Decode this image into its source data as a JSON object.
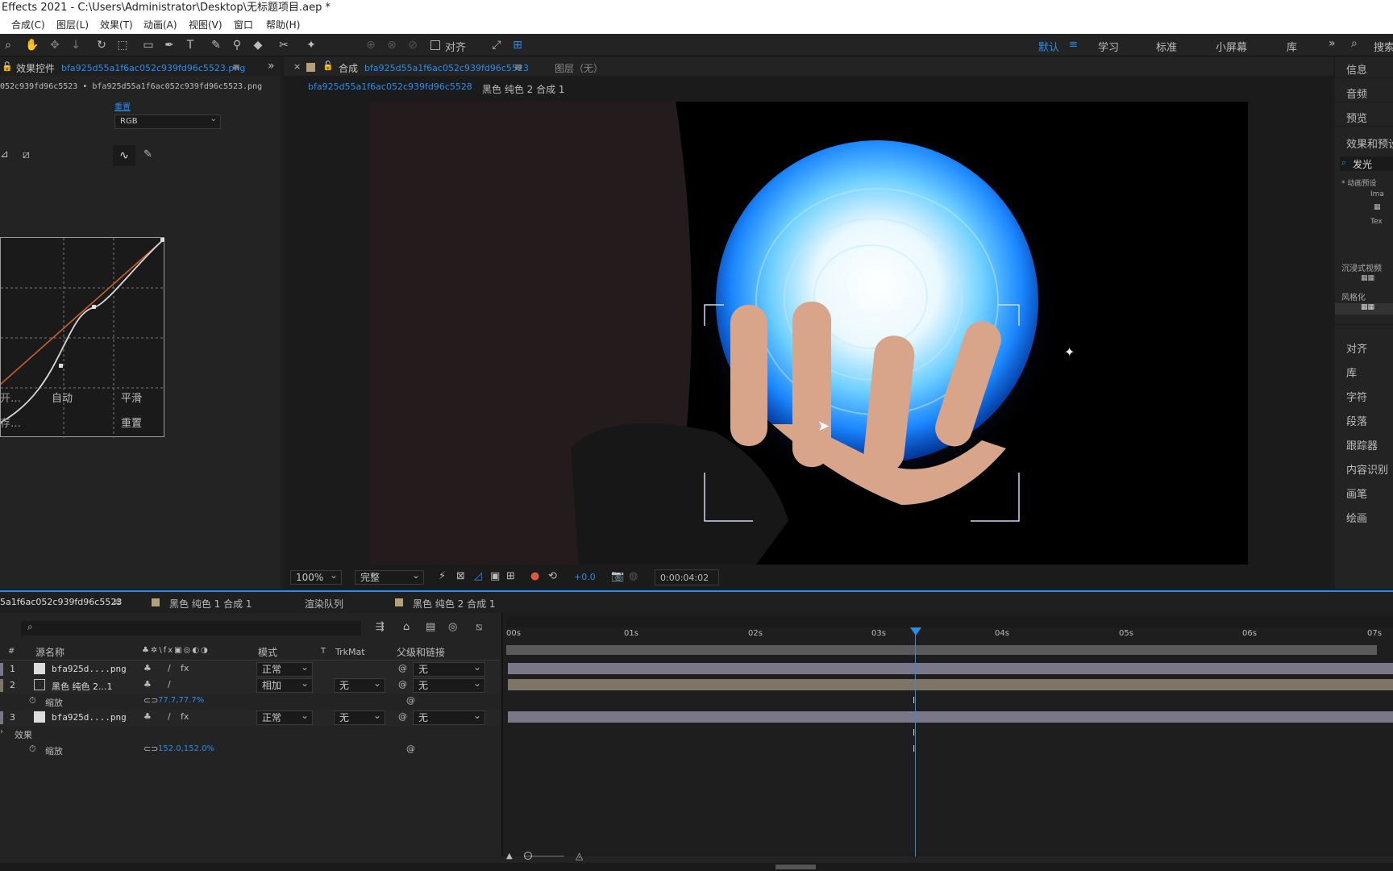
{
  "title": "Effects 2021 - C:\\Users\\Administrator\\Desktop\\无标题项目.aep *",
  "menu": [
    "合成(C)",
    "图层(L)",
    "效果(T)",
    "动画(A)",
    "视图(V)",
    "窗口",
    "帮助(H)"
  ],
  "toolbar": {
    "align_label": "对齐",
    "workspaces": [
      "默认",
      "学习",
      "标准",
      "小屏幕",
      "库"
    ],
    "search_label": "搜索"
  },
  "effects": {
    "tab_label": "效果控件",
    "layer_name": "bfa925d55a1f6ac052c939fd96c5523.png",
    "path": "052c939fd96c5523 • bfa925d55a1f6ac052c939fd96c5523.png",
    "reset_label": "重置",
    "channel": "RGB",
    "buttons": {
      "auto": "自动",
      "smooth": "平滑",
      "reset": "重置",
      "open": "开…",
      "save": "存…"
    }
  },
  "comp": {
    "tab_label": "合成",
    "comp_name": "bfa925d55a1f6ac052c939fd96c5523",
    "layer_tab": "图层（无）",
    "crumb_active": "bfa925d55a1f6ac052c939fd96c5523",
    "crumb_2": "黑色 纯色 2 合成 1",
    "zoom": "100%",
    "quality": "完整",
    "exposure": "+0.0",
    "timecode": "0:00:04:02"
  },
  "right_panel": {
    "top_items": [
      "信息",
      "音频",
      "预览",
      "效果和预设"
    ],
    "search_value": "发光",
    "tree": [
      "* 动画预设",
      "Ima",
      "Tex",
      "沉浸式视频",
      "风格化"
    ],
    "bottom_items": [
      "对齐",
      "库",
      "字符",
      "段落",
      "跟踪器",
      "内容识别",
      "画笔",
      "绘画"
    ]
  },
  "timeline": {
    "tabs": [
      "5a1f6ac052c939fd96c5523",
      "黑色 纯色 1 合成 1",
      "渲染队列",
      "黑色 纯色 2 合成 1"
    ],
    "headers": {
      "num": "#",
      "source": "源名称",
      "mode": "模式",
      "t": "T",
      "trkmat": "TrkMat",
      "parent": "父级和链接"
    },
    "layers": [
      {
        "num": "1",
        "name": "bfa925d....png",
        "mode": "正常",
        "trkmat": "",
        "parent": "无"
      },
      {
        "num": "2",
        "name": "黑色 纯色 2...1",
        "mode": "相加",
        "trkmat": "无",
        "parent": "无"
      },
      {
        "num": "3",
        "name": "bfa925d....png",
        "mode": "正常",
        "trkmat": "无",
        "parent": "无"
      }
    ],
    "props": [
      {
        "label": "缩放",
        "value": "77.7,77.7%"
      },
      {
        "label": "效果"
      },
      {
        "label": "缩放",
        "value": "152.0,152.0%"
      }
    ],
    "ruler": [
      "00s",
      "01s",
      "02s",
      "03s",
      "04s",
      "05s",
      "06s",
      "07s"
    ],
    "playhead_time": "04s"
  },
  "colors": {
    "accent": "#2d8ceb",
    "bar_layer": "#7a7789",
    "bar_solid": "#7e7566"
  }
}
